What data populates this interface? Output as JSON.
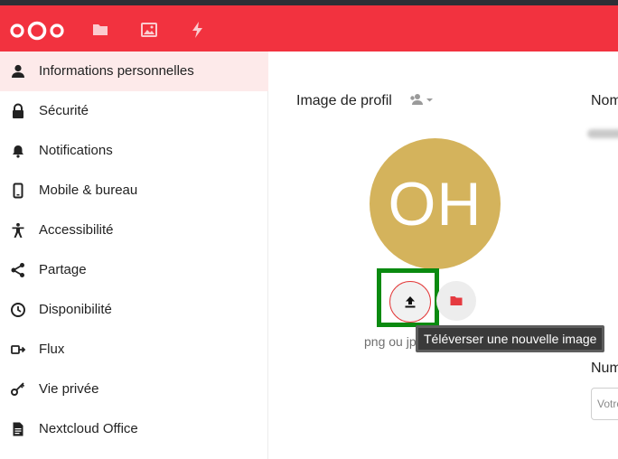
{
  "sidebar": {
    "items": [
      {
        "label": "Informations personnelles",
        "icon": "user-icon",
        "active": true
      },
      {
        "label": "Sécurité",
        "icon": "lock-icon"
      },
      {
        "label": "Notifications",
        "icon": "bell-icon"
      },
      {
        "label": "Mobile & bureau",
        "icon": "phone-icon"
      },
      {
        "label": "Accessibilité",
        "icon": "accessibility-icon"
      },
      {
        "label": "Partage",
        "icon": "share-icon"
      },
      {
        "label": "Disponibilité",
        "icon": "clock-icon"
      },
      {
        "label": "Flux",
        "icon": "activity-icon"
      },
      {
        "label": "Vie privée",
        "icon": "key-icon"
      },
      {
        "label": "Nextcloud Office",
        "icon": "document-icon"
      }
    ]
  },
  "header": {
    "apps": [
      "folder-icon",
      "image-icon",
      "lightning-icon"
    ],
    "brand_color": "#f2323f"
  },
  "profile": {
    "title": "Image de profil",
    "avatar_initials": "OH",
    "avatar_color": "#d4b35c",
    "hint": "png ou jpg",
    "tooltip": "Téléverser une nouvelle image"
  },
  "fields": {
    "name_label": "Nom",
    "number_label": "Num",
    "number_placeholder": "Votre"
  }
}
